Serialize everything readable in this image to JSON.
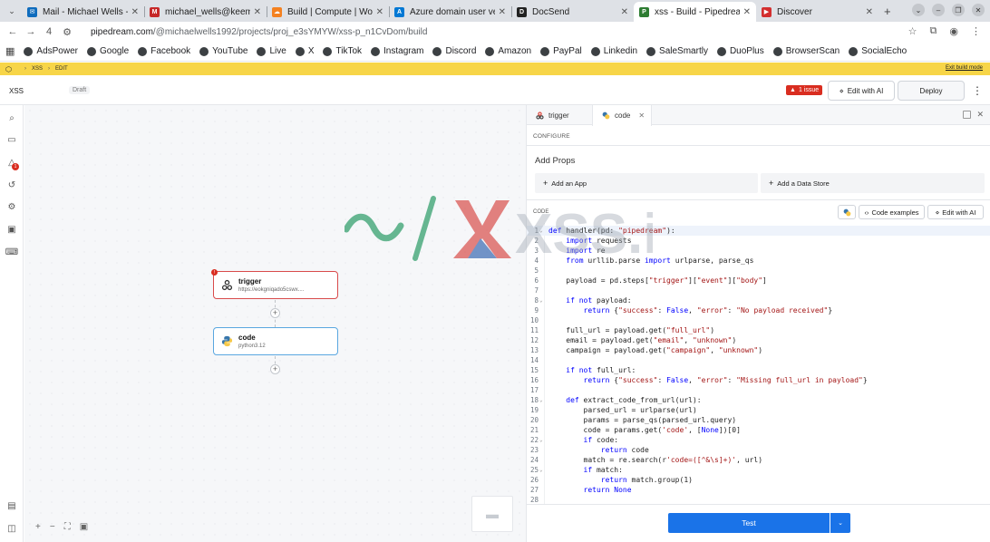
{
  "browser": {
    "tabs": [
      {
        "label": "Mail - Michael Wells - Out",
        "color": "#0f6cbd",
        "glyph": "✉",
        "active": false
      },
      {
        "label": "michael_wells@keemail.",
        "color": "#c62828",
        "glyph": "M",
        "active": false
      },
      {
        "label": "Build | Compute | Worke",
        "color": "#f48120",
        "glyph": "☁",
        "active": false
      },
      {
        "label": "Azure domain user verif",
        "color": "#0078d4",
        "glyph": "A",
        "active": false
      },
      {
        "label": "DocSend",
        "color": "#222222",
        "glyph": "D",
        "active": false
      },
      {
        "label": "xss - Build - Pipedream",
        "color": "#2e7d32",
        "glyph": "P",
        "active": true
      },
      {
        "label": "Discover",
        "color": "#d32f2f",
        "glyph": "▶",
        "active": false
      }
    ],
    "url_host": "pipedream.com",
    "url_path": "/@michaelwells1992/projects/proj_e3sYMYW/xss-p_n1CvDom/build",
    "tab_count": "4",
    "bookmarks": [
      "AdsPower",
      "Google",
      "Facebook",
      "YouTube",
      "Live",
      "X",
      "TikTok",
      "Instagram",
      "Discord",
      "Amazon",
      "PayPal",
      "Linkedin",
      "SaleSmartly",
      "DuoPlus",
      "BrowserScan",
      "SocialEcho"
    ]
  },
  "banner": {
    "crumb1": "XSS",
    "crumb2": "EDIT",
    "exit_label": "Exit build mode"
  },
  "header": {
    "workflow_name": "XSS",
    "status": "Draft",
    "issue_label": "1 issue",
    "edit_ai_label": "Edit with AI",
    "deploy_label": "Deploy"
  },
  "rail": {
    "alert_count": "1"
  },
  "canvas": {
    "trigger": {
      "title": "trigger",
      "subtitle": "https://eokgniqado5cswx....",
      "error_count": "!"
    },
    "code": {
      "title": "code",
      "subtitle": "python3.12"
    }
  },
  "watermark": {
    "text": "XSS.is"
  },
  "panel": {
    "tab_trigger": "trigger",
    "tab_code": "code",
    "configure_label": "CONFIGURE",
    "add_props_label": "Add Props",
    "add_app_label": "Add an App",
    "add_store_label": "Add a Data Store",
    "code_label": "CODE",
    "code_examples_label": "Code examples",
    "edit_ai_label": "Edit with AI",
    "test_label": "Test",
    "code_lines": [
      "def handler(pd: \"pipedream\"):",
      "    import requests",
      "    import re",
      "    from urllib.parse import urlparse, parse_qs",
      "",
      "    payload = pd.steps[\"trigger\"][\"event\"][\"body\"]",
      "",
      "    if not payload:",
      "        return {\"success\": False, \"error\": \"No payload received\"}",
      "",
      "    full_url = payload.get(\"full_url\")",
      "    email = payload.get(\"email\", \"unknown\")",
      "    campaign = payload.get(\"campaign\", \"unknown\")",
      "",
      "    if not full_url:",
      "        return {\"success\": False, \"error\": \"Missing full_url in payload\"}",
      "",
      "    def extract_code_from_url(url):",
      "        parsed_url = urlparse(url)",
      "        params = parse_qs(parsed_url.query)",
      "        code = params.get('code', [None])[0]",
      "        if code:",
      "            return code",
      "        match = re.search(r'code=([^&\\s]+)', url)",
      "        if match:",
      "            return match.group(1)",
      "        return None",
      ""
    ],
    "fold_lines": [
      1,
      8,
      18,
      22,
      25
    ]
  }
}
